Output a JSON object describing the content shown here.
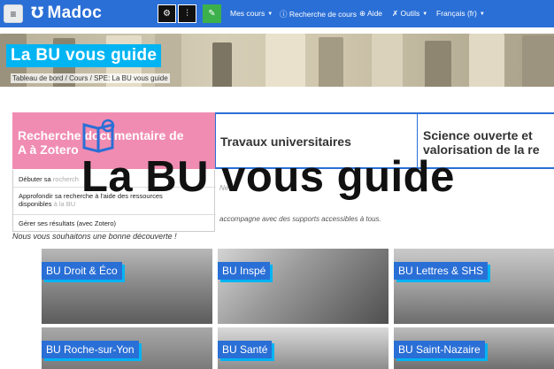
{
  "navbar": {
    "logo_text": "Madoc",
    "items": [
      {
        "label": "Mes cours",
        "has_caret": true
      },
      {
        "label": "Recherche de cours",
        "icon": "info-icon"
      },
      {
        "label": "Aide",
        "icon": "globe-icon"
      },
      {
        "label": "Outils",
        "icon": "wrench-icon",
        "has_caret": true
      },
      {
        "label": "Français (fr)",
        "has_caret": true
      }
    ]
  },
  "banner": {
    "title": "La BU vous guide",
    "breadcrumb": [
      "Tableau de bord",
      "Cours",
      "SPE: La BU vous guide"
    ]
  },
  "tabs": [
    {
      "label_line1": "Recherche documentaire de",
      "label_line2": "A à Zotero"
    },
    {
      "label_line1": "Travaux universitaires",
      "label_line2": ""
    },
    {
      "label_line1": "Science ouverte et",
      "label_line2": "valorisation de la re"
    }
  ],
  "dropdown": {
    "items": [
      {
        "text": "Débuter sa",
        "faded": " rocherch"
      },
      {
        "text": "Approfondir sa recherche à l'aide des ressources",
        "text2": "disponibles",
        "faded": " à la BU"
      },
      {
        "text": "Gérer ses résultats (avec Zotero)"
      }
    ]
  },
  "intro": {
    "line1_fragment": "Ne",
    "line2_fragment": "accompagne avec des supports accessibles à tous.",
    "welcome": "Nous vous souhaitons une bonne découverte !"
  },
  "overlay_title": "La BU vous guide",
  "cards": [
    {
      "label": "BU Droit & Éco"
    },
    {
      "label": "BU Inspé"
    },
    {
      "label": "BU Lettres & SHS"
    },
    {
      "label": "BU Roche-sur-Yon"
    },
    {
      "label": "BU Santé"
    },
    {
      "label": "BU Saint-Nazaire"
    }
  ],
  "colors": {
    "navbar": "#2a6fd6",
    "accent": "#03b4f2",
    "pink_tab": "#f08cb2"
  }
}
